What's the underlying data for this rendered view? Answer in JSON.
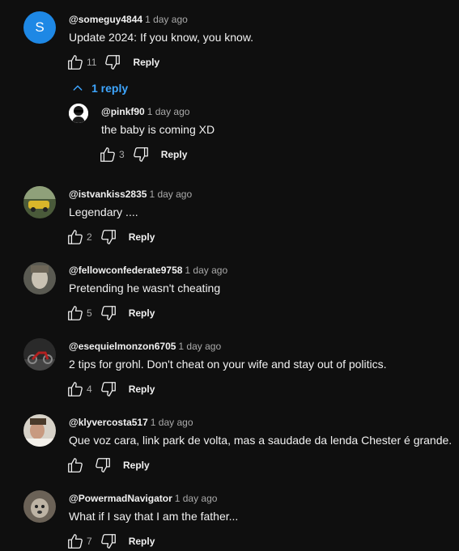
{
  "comments": [
    {
      "handle": "@someguy4844",
      "time": "1 day ago",
      "text": "Update 2024:  If you know, you know.",
      "likes": "11",
      "reply_label": "Reply",
      "avatar_letter": "S",
      "replies_toggle": "1 reply",
      "replies": [
        {
          "handle": "@pinkf90",
          "time": "1 day ago",
          "text": "the baby is coming XD",
          "likes": "3",
          "reply_label": "Reply"
        }
      ]
    },
    {
      "handle": "@istvankiss2835",
      "time": "1 day ago",
      "text": "Legendary ....",
      "likes": "2",
      "reply_label": "Reply"
    },
    {
      "handle": "@fellowconfederate9758",
      "time": "1 day ago",
      "text": "Pretending he wasn't cheating",
      "likes": "5",
      "reply_label": "Reply"
    },
    {
      "handle": "@esequielmonzon6705",
      "time": "1 day ago",
      "text": "2 tips for grohl. Don't cheat on your wife and stay out of politics.",
      "likes": "4",
      "reply_label": "Reply"
    },
    {
      "handle": "@klyvercosta517",
      "time": "1 day ago",
      "text": "Que voz cara, link park de volta, mas a saudade da lenda Chester é grande.",
      "likes": "",
      "reply_label": "Reply"
    },
    {
      "handle": "@PowermadNavigator",
      "time": "1 day ago",
      "text": "What if I say that I am the father...",
      "likes": "7",
      "reply_label": "Reply"
    }
  ],
  "colors": {
    "background": "#0f0f0f",
    "text": "#f1f1f1",
    "muted": "#aaaaaa",
    "link": "#3ea6ff",
    "avatar_blue": "#1e88e5"
  },
  "icons": {
    "like": "thumbs-up-icon",
    "dislike": "thumbs-down-icon",
    "expand": "chevron-up-icon"
  }
}
